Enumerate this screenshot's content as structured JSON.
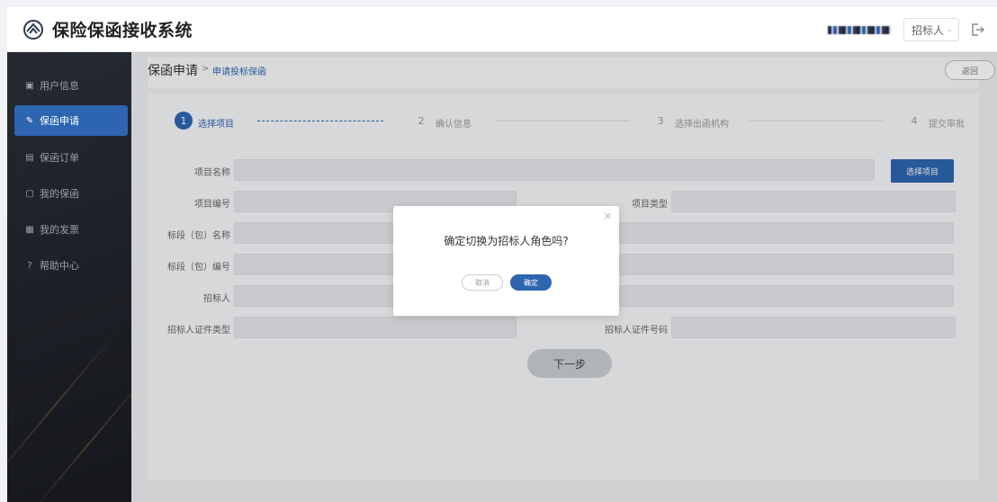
{
  "header": {
    "app_title": "保险保函接收系统",
    "role_selected": "招标人"
  },
  "sidebar": {
    "items": [
      {
        "icon": "user-info-icon",
        "label": "用户信息"
      },
      {
        "icon": "apply-icon",
        "label": "保函申请"
      },
      {
        "icon": "order-icon",
        "label": "保函订单"
      },
      {
        "icon": "my-guarantee-icon",
        "label": "我的保函"
      },
      {
        "icon": "invoice-icon",
        "label": "我的发票"
      },
      {
        "icon": "help-icon",
        "label": "帮助中心"
      }
    ],
    "active_index": 1
  },
  "breadcrumb": {
    "main": "保函申请",
    "separator": ">",
    "sub": "申请投标保函",
    "back_label": "返回"
  },
  "steps": [
    {
      "number": "1",
      "label": "选择项目",
      "active": true
    },
    {
      "number": "2",
      "label": "确认信息",
      "active": false
    },
    {
      "number": "3",
      "label": "选择出函机构",
      "active": false
    },
    {
      "number": "4",
      "label": "提交审批",
      "active": false
    }
  ],
  "form": {
    "project_name_label": "项目名称",
    "select_project_btn": "选择项目",
    "project_no_label": "项目编号",
    "project_type_label": "项目类型",
    "section_name_label": "标段（包）名称",
    "section_no_label": "标段（包）编号",
    "tenderer_label": "招标人",
    "tenderer_cert_type_label": "招标人证件类型",
    "tenderer_cert_no_label": "招标人证件号码",
    "next_btn": "下一步"
  },
  "modal": {
    "message": "确定切换为招标人角色吗?",
    "cancel_label": "取消",
    "ok_label": "确定"
  },
  "colors": {
    "primary": "#2d65b0",
    "sidebar_bg": "#1f2228"
  }
}
